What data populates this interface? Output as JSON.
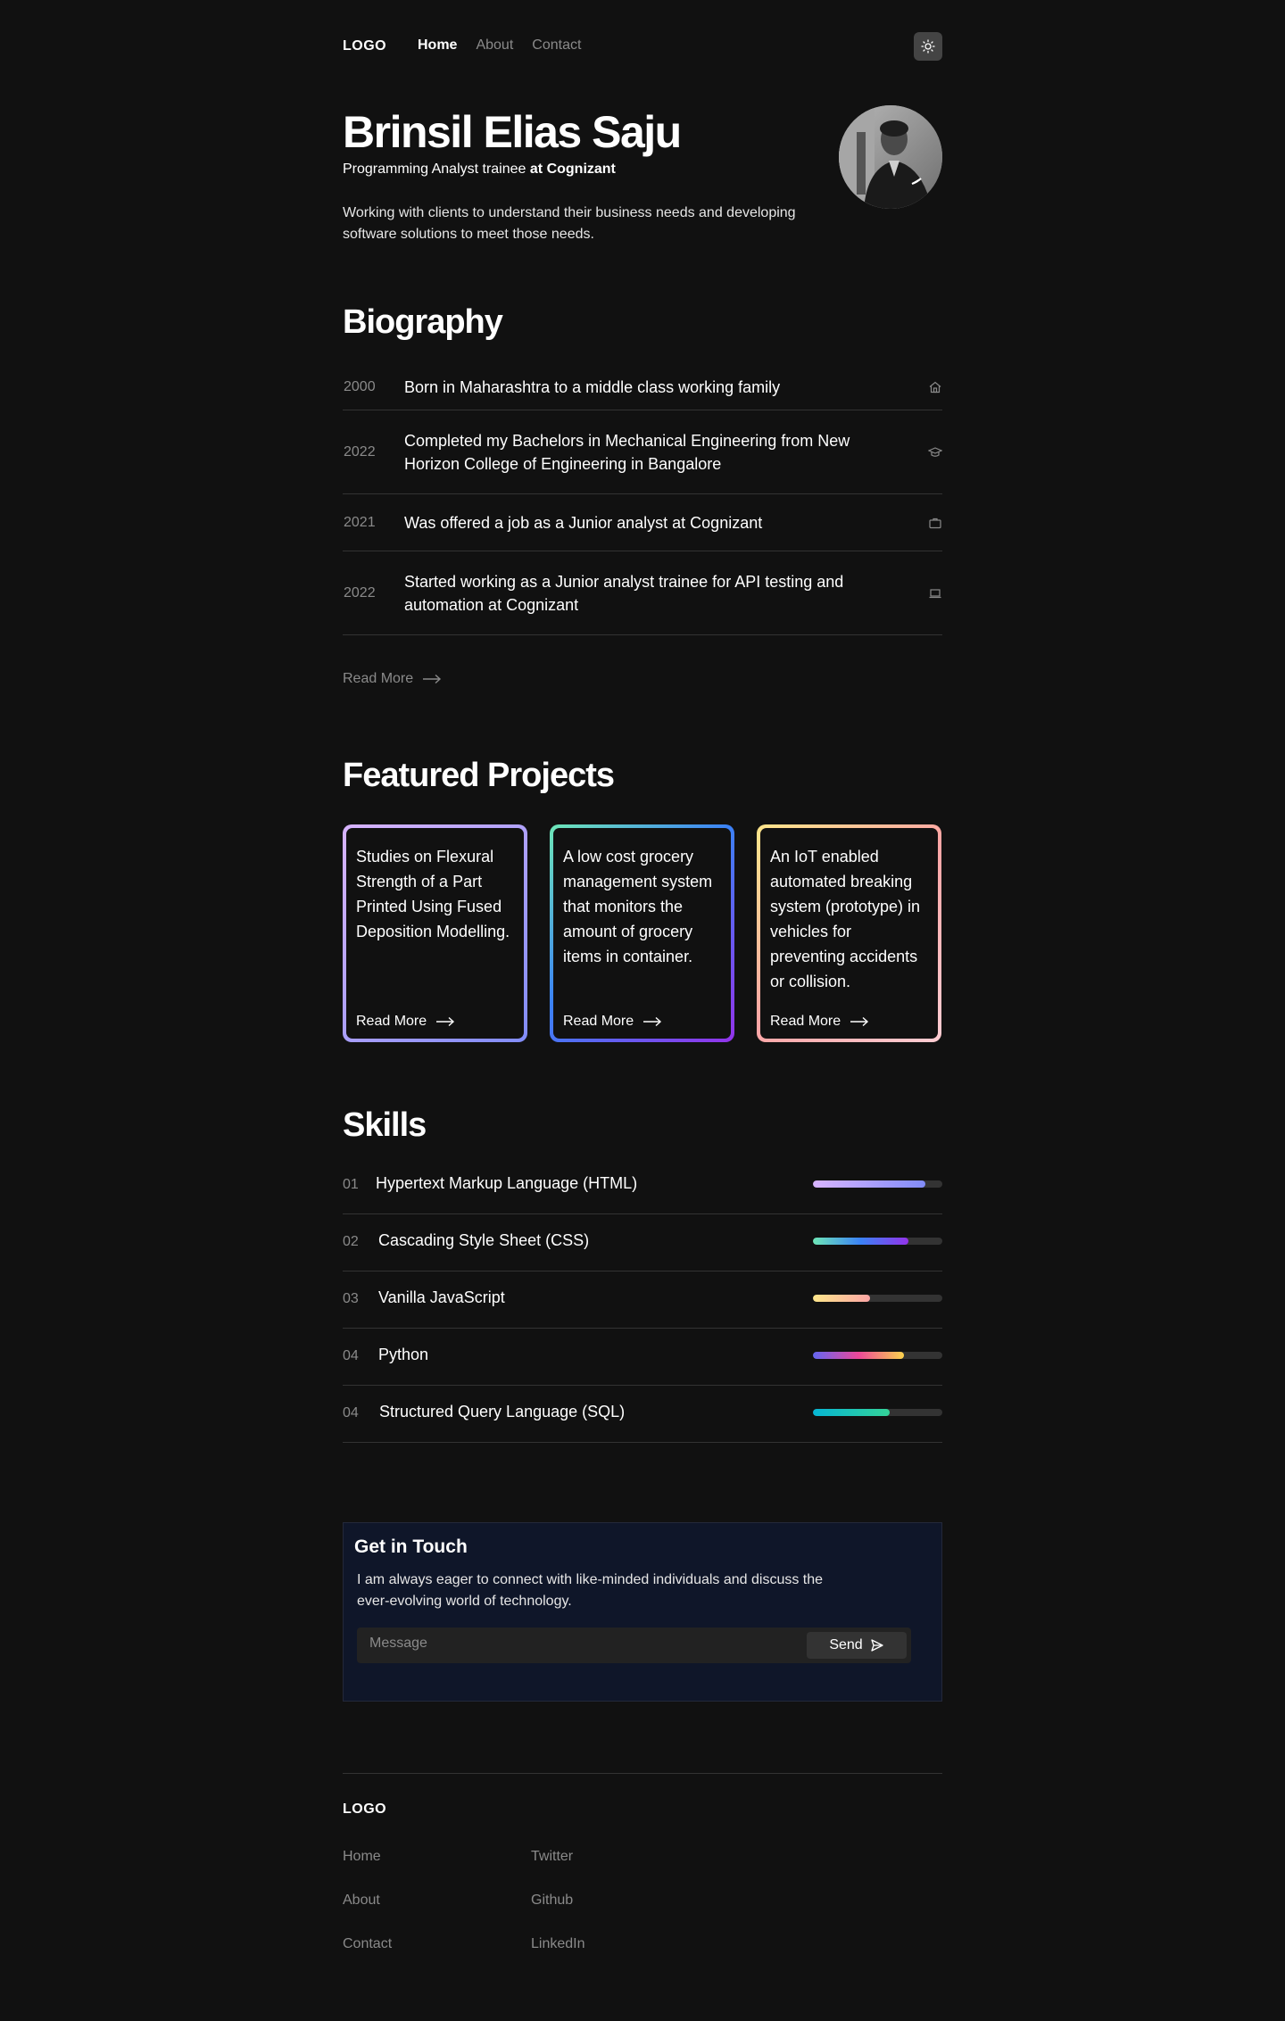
{
  "nav": {
    "logo": "LOGO",
    "links": [
      "Home",
      "About",
      "Contact"
    ]
  },
  "hero": {
    "name": "Brinsil Elias Saju",
    "role_prefix": "Programming Analyst trainee",
    "role_company": "at Cognizant",
    "description": "Working with clients to understand their business needs and developing software solutions to meet those needs."
  },
  "biography": {
    "title": "Biography",
    "items": [
      {
        "year": "2000",
        "text": "Born in Maharashtra to a middle class working family",
        "icon": "home-icon"
      },
      {
        "year": "2022",
        "text": "Completed my Bachelors in Mechanical Engineering from New Horizon College of Engineering in Bangalore",
        "icon": "graduation-cap-icon"
      },
      {
        "year": "2021",
        "text": "Was offered a job as a Junior analyst at Cognizant",
        "icon": "briefcase-icon"
      },
      {
        "year": "2022",
        "text": "Started working as a Junior analyst trainee for API testing and automation at Cognizant",
        "icon": "laptop-icon"
      }
    ],
    "read_more": "Read More"
  },
  "projects": {
    "title": "Featured Projects",
    "items": [
      {
        "text": "Studies on Flexural Strength of a Part Printed Using Fused Deposition Modelling.",
        "link": "Read More",
        "gradient": [
          "#d8b4fe",
          "#818cf8"
        ]
      },
      {
        "text": "A low cost grocery management system that monitors the amount of grocery items in container.",
        "link": "Read More",
        "gradient": [
          "#6ee7b7",
          "#3b82f6",
          "#9333ea"
        ]
      },
      {
        "text": "An IoT enabled automated breaking system (prototype) in vehicles for preventing accidents or collision.",
        "link": "Read More",
        "gradient": [
          "#fde68a",
          "#fca5a5",
          "#fecdd3"
        ]
      }
    ]
  },
  "skills": {
    "title": "Skills",
    "items": [
      {
        "num": "01",
        "name": "Hypertext Markup Language (HTML)",
        "level": 0.87,
        "gradient": [
          "#d8b4fe",
          "#818cf8"
        ]
      },
      {
        "num": "02",
        "name": "Cascading Style Sheet (CSS)",
        "level": 0.74,
        "gradient": [
          "#6ee7b7",
          "#3b82f6",
          "#9333ea"
        ]
      },
      {
        "num": "03",
        "name": "Vanilla JavaScript",
        "level": 0.44,
        "gradient": [
          "#fde68a",
          "#fca5a5"
        ]
      },
      {
        "num": "04",
        "name": "Python",
        "level": 0.7,
        "gradient": [
          "#6366f1",
          "#ec4899",
          "#fcd34d"
        ]
      },
      {
        "num": "04",
        "name": "Structured Query Language (SQL)",
        "level": 0.59,
        "gradient": [
          "#06b6d4",
          "#34d399"
        ]
      }
    ]
  },
  "contact": {
    "title": "Get in Touch",
    "description": "I am always eager to connect with like-minded individuals and discuss the ever-evolving world of technology.",
    "placeholder": "Message",
    "send_label": "Send"
  },
  "footer": {
    "logo": "LOGO",
    "col1": [
      "Home",
      "About",
      "Contact"
    ],
    "col2": [
      "Twitter",
      "Github",
      "LinkedIn"
    ]
  }
}
